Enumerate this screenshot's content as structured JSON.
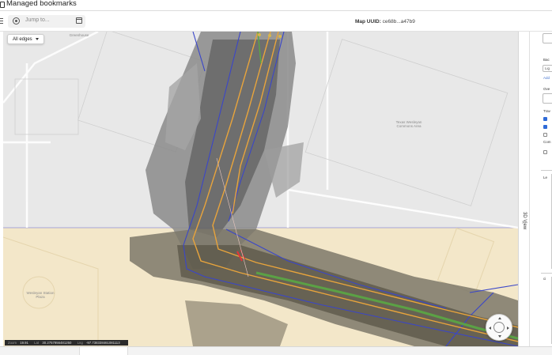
{
  "title": "Managed bookmarks",
  "toolbar": {
    "jump_placeholder": "Jump to...",
    "map_uuid_label": "Map UUID:",
    "map_uuid_value": "ce68b...a47b9"
  },
  "map": {
    "edges_dropdown": "All edges",
    "labels": {
      "top_left": "Greenhouse",
      "building_right": "Texas Wesleyan Commons Area",
      "circle_left": "Wesleyan Station Plaza"
    },
    "status": {
      "zoom_label": "Zoom",
      "zoom_value": "19.91",
      "lat_label": "Lat",
      "lat_value": "30.2757956481250",
      "lng_label": "Lng",
      "lng_value": "-97.738338461081113"
    }
  },
  "side_tab": {
    "label": "3D View"
  },
  "right_panel": {
    "section1_label": "Bac",
    "select_value": "Lig",
    "add_link": "Add",
    "section2_label": "Ove",
    "section3_label": "Trav",
    "section4_label": "Com",
    "list_item_1": "Le",
    "list_item_2": "ci"
  },
  "colors": {
    "route_orange": "#e8a43c",
    "edge_blue": "#3a46c9",
    "green_path": "#5aa844",
    "sand": "#f3e7c9"
  }
}
